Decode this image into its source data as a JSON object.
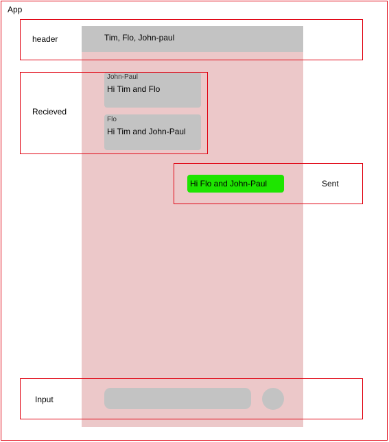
{
  "app": {
    "label": "App"
  },
  "header": {
    "label": "header",
    "title": "Tim, Flo, John-paul"
  },
  "received": {
    "label": "Recieved",
    "messages": [
      {
        "sender": "John-Paul",
        "text": "Hi Tim and Flo"
      },
      {
        "sender": "Flo",
        "text": "Hi Tim and John-Paul"
      }
    ]
  },
  "sent": {
    "label": "Sent",
    "messages": [
      {
        "text": "Hi Flo and John-Paul"
      }
    ]
  },
  "input": {
    "label": "Input"
  },
  "colors": {
    "region_border": "#e0000f",
    "phone_background": "#ecc8c9",
    "placeholder_gray": "#c3c3c3",
    "sent_bubble": "#1ee500"
  }
}
